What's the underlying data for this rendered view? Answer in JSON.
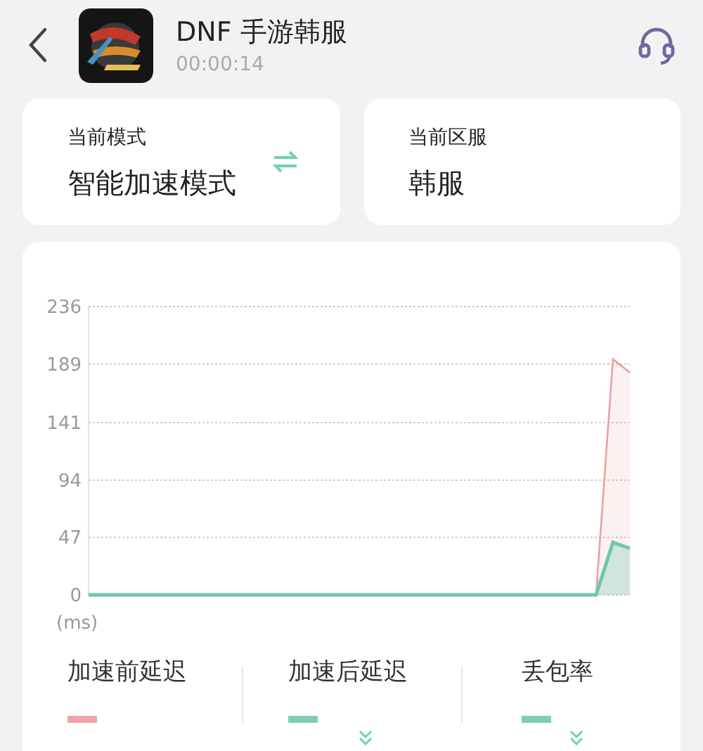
{
  "header": {
    "title": "DNF 手游韩服",
    "elapsed": "00:00:14"
  },
  "info_cards": [
    {
      "label": "当前模式",
      "value": "智能加速模式",
      "switchable": true
    },
    {
      "label": "当前区服",
      "value": "韩服",
      "switchable": false
    }
  ],
  "latency_chart": {
    "chart_data": {
      "type": "area",
      "ylabel": "(ms)",
      "ylim": [
        0,
        236
      ],
      "yticks": [
        0,
        47,
        94,
        141,
        189,
        236
      ],
      "grid": true,
      "series": [
        {
          "color": "#e8a0a4",
          "values": [
            null,
            null,
            null,
            null,
            null,
            null,
            null,
            null,
            null,
            null,
            null,
            null,
            null,
            null,
            null,
            null,
            null,
            null,
            null,
            null,
            null,
            null,
            null,
            null,
            null,
            null,
            null,
            null,
            null,
            null,
            0,
            193,
            182
          ]
        },
        {
          "color": "#6cc9ac",
          "values": [
            0,
            0,
            0,
            0,
            0,
            0,
            0,
            0,
            0,
            0,
            0,
            0,
            0,
            0,
            0,
            0,
            0,
            0,
            0,
            0,
            0,
            0,
            0,
            0,
            0,
            0,
            0,
            0,
            0,
            0,
            0,
            43,
            38
          ]
        }
      ]
    }
  },
  "stats": [
    {
      "label": "加速前延迟",
      "color": "#f0a4aa",
      "trend_down": false
    },
    {
      "label": "加速后延迟",
      "color": "#7fcdb8",
      "trend_down": true
    },
    {
      "label": "丢包率",
      "color": "#7fcdb8",
      "trend_down": true
    }
  ]
}
